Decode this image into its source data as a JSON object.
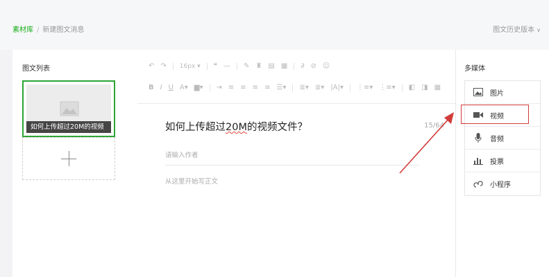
{
  "breadcrumb": {
    "root": "素材库",
    "separator": "/",
    "current": "新建图文消息"
  },
  "history": {
    "label": "图文历史版本"
  },
  "left_panel": {
    "title": "图文列表",
    "card_title": "如何上传超过20M的视频"
  },
  "toolbar": {
    "font_size": "16px"
  },
  "editor": {
    "title_prefix": "如何上传超过",
    "title_underlined": "20M",
    "title_suffix": "的视频文件？",
    "char_count": "15/64",
    "author_placeholder": "请输入作者",
    "body_placeholder": "从这里开始写正文"
  },
  "right_panel": {
    "title": "多媒体",
    "items": [
      {
        "label": "图片",
        "icon": "image-icon"
      },
      {
        "label": "视频",
        "icon": "video-icon"
      },
      {
        "label": "音频",
        "icon": "microphone-icon"
      },
      {
        "label": "投票",
        "icon": "vote-chart-icon"
      },
      {
        "label": "小程序",
        "icon": "mini-program-icon"
      }
    ]
  },
  "colors": {
    "accent_green": "#1aad19",
    "highlight_red": "#d23a3a"
  }
}
